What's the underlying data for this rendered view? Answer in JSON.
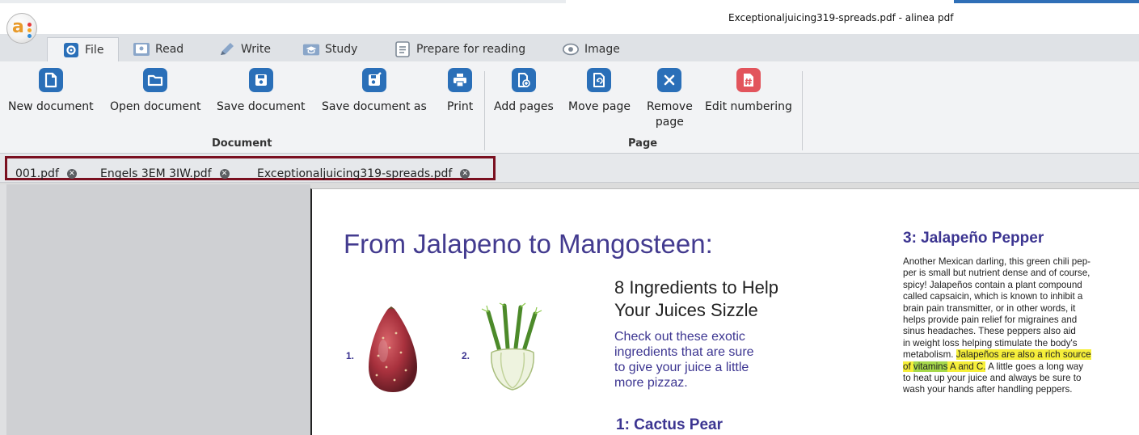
{
  "window": {
    "title": "Exceptionaljuicing319-spreads.pdf - alinea pdf",
    "app_logo": "alinea-logo"
  },
  "menu_tabs": [
    {
      "label": "File",
      "icon": "gear-icon",
      "active": true
    },
    {
      "label": "Read",
      "icon": "reader-icon",
      "active": false
    },
    {
      "label": "Write",
      "icon": "pencil-icon",
      "active": false
    },
    {
      "label": "Study",
      "icon": "graduation-icon",
      "active": false
    },
    {
      "label": "Prepare for reading",
      "icon": "list-document-icon",
      "active": false
    },
    {
      "label": "Image",
      "icon": "eye-icon",
      "active": false
    }
  ],
  "ribbon": {
    "document_group": {
      "label": "Document",
      "buttons": [
        {
          "label": "New document",
          "icon": "new-document-icon"
        },
        {
          "label": "Open document",
          "icon": "folder-icon"
        },
        {
          "label": "Save document",
          "icon": "save-icon"
        },
        {
          "label": "Save document as",
          "icon": "save-as-icon"
        },
        {
          "label": "Print",
          "icon": "print-icon"
        }
      ]
    },
    "page_group": {
      "label": "Page",
      "buttons": [
        {
          "label": "Add pages",
          "icon": "add-page-icon"
        },
        {
          "label": "Move page",
          "icon": "move-page-icon"
        },
        {
          "label": "Remove",
          "label2": "page",
          "icon": "remove-icon"
        },
        {
          "label": "Edit numbering",
          "icon": "numbering-icon"
        }
      ]
    }
  },
  "document_tabs": [
    {
      "label": "001.pdf"
    },
    {
      "label": "Engels 3EM 3IW.pdf"
    },
    {
      "label": "Exceptionaljuicing319-spreads.pdf"
    }
  ],
  "pdf_page": {
    "title": "From Jalapeno to Mangosteen:",
    "subtitle_line1": "8 Ingredients to Help",
    "subtitle_line2": "Your Juices Sizzle",
    "intro_line1": "Check out these exotic",
    "intro_line2": "ingredients that are sure",
    "intro_line3": "to give your juice a little",
    "intro_line4": "more pizzaz.",
    "label1": "1.",
    "label2": "2.",
    "section1_heading": "1: Cactus Pear",
    "section3_heading": "3: Jalapeño Pepper",
    "section3_lines": [
      "Another Mexican darling, this green chili pep-",
      "per is small but nutrient dense and of course,",
      "spicy! Jalapeños contain a plant compound",
      "called capsaicin, which is known to inhibit a",
      "brain pain transmitter, or in other words, it",
      "helps provide pain relief for migraines and",
      "sinus headaches. These peppers also aid",
      "in weight loss helping stimulate the body's"
    ],
    "section3_line9_plain": "metabolism. ",
    "section3_line9_highlight": "Jalapeños are also a rich source",
    "section3_line10_hl_a": "of ",
    "section3_line10_hl_green": "vitamins",
    "section3_line10_hl_b": " A and C.",
    "section3_line10_rest": " A little goes a long way",
    "section3_line11": "to heat up your juice and always be sure to",
    "section3_line12": "wash your hands after handling peppers."
  },
  "colors": {
    "accent_blue": "#2a6fb8",
    "heading_purple": "#3c3591",
    "highlight_yellow": "#f6ef3a",
    "highlight_green": "#a6d84a",
    "tab_frame": "#7a1020",
    "numbering_red": "#e2545c"
  }
}
